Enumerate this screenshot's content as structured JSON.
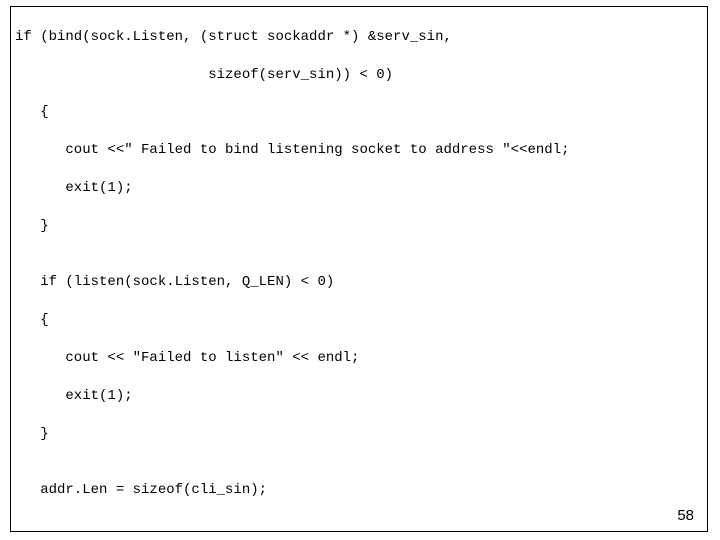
{
  "code": {
    "lines": [
      "if (bind(sock.Listen, (struct sockaddr *) &serv_sin,",
      "                       sizeof(serv_sin)) < 0)",
      "   {",
      "      cout <<\" Failed to bind listening socket to address \"<<endl;",
      "      exit(1);",
      "   }",
      "",
      "   if (listen(sock.Listen, Q_LEN) < 0)",
      "   {",
      "      cout << \"Failed to listen\" << endl;",
      "      exit(1);",
      "   }",
      "",
      "   addr.Len = sizeof(cli_sin);"
    ]
  },
  "page_number": "58"
}
